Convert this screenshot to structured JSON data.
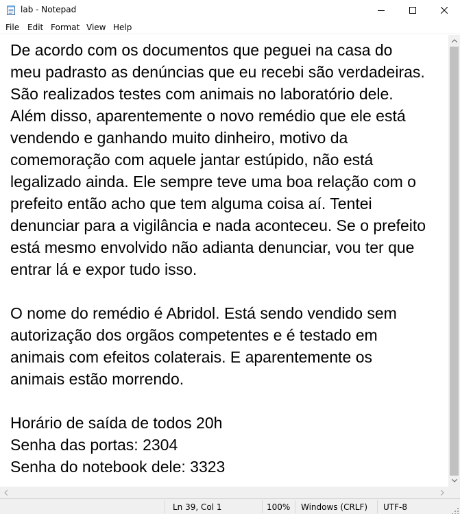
{
  "window": {
    "title": "lab - Notepad",
    "app_icon": "notepad-icon",
    "controls": [
      "minimize-icon",
      "maximize-icon",
      "close-icon"
    ]
  },
  "menu": [
    "File",
    "Edit",
    "Format",
    "View",
    "Help"
  ],
  "editor": {
    "content": "De acordo com os documentos que peguei na casa do\nmeu padrasto as denúncias que eu recebi são verdadeiras.\nSão realizados testes com animais no laboratório dele.\nAlém disso, aparentemente o novo remédio que ele está\nvendendo e ganhando muito dinheiro, motivo da\ncomemoração com aquele jantar estúpido, não está\nlegalizado ainda. Ele sempre teve uma boa relação com o\nprefeito então acho que tem alguma coisa aí. Tentei\ndenunciar para a vigilância e nada aconteceu. Se o prefeito\nestá mesmo envolvido não adianta denunciar, vou ter que\nentrar lá e expor tudo isso.\n\nO nome do remédio é Abridol. Está sendo vendido sem\nautorização dos orgãos competentes e é testado em\nanimais com efeitos colaterais. E aparentemente os\nanimais estão morrendo.\n\nHorário de saída de todos 20h\nSenha das portas: 2304\nSenha do notebook dele: 3323"
  },
  "status": {
    "position": "Ln 39, Col 1",
    "zoom": "100%",
    "line_ending": "Windows (CRLF)",
    "encoding": "UTF-8"
  }
}
